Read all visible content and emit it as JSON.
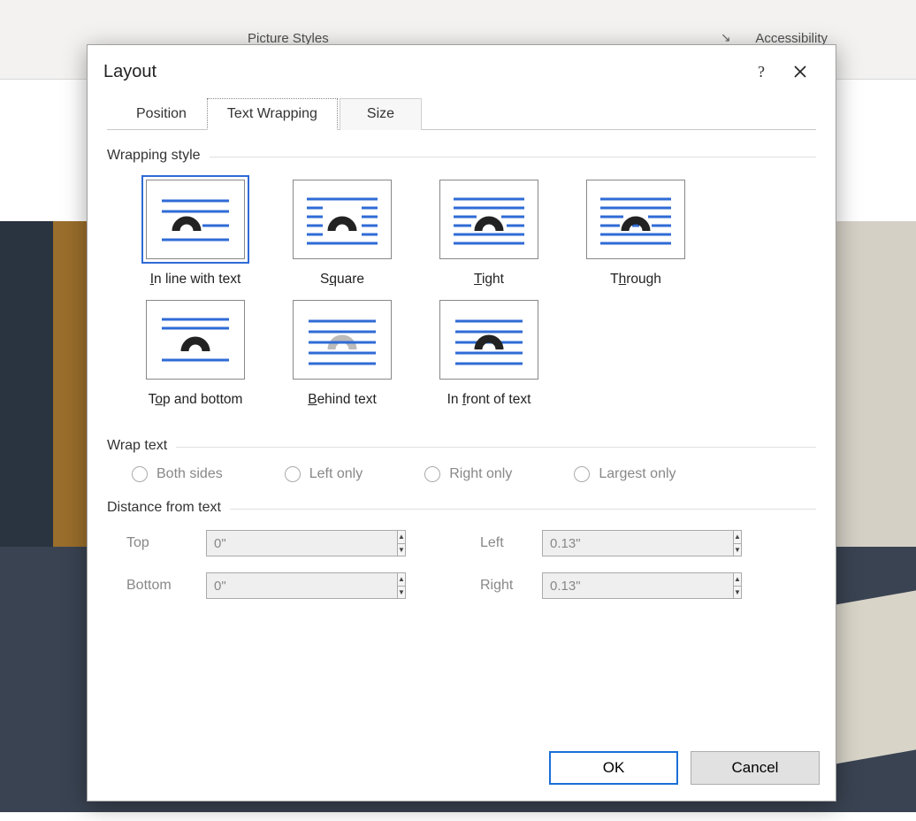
{
  "ribbon": {
    "group_styles": "Picture Styles",
    "group_access": "Accessibility"
  },
  "dialog": {
    "title": "Layout",
    "tabs": {
      "position": "Position",
      "wrapping": "Text Wrapping",
      "size": "Size"
    },
    "wrapping_style_label": "Wrapping style",
    "styles": {
      "inline": "In line with text",
      "square": "Square",
      "tight": "Tight",
      "through": "Through",
      "topbottom": "Top and bottom",
      "behind": "Behind text",
      "infront": "In front of text"
    },
    "wrap_text_label": "Wrap text",
    "wrap_options": {
      "both": "Both sides",
      "left": "Left only",
      "right": "Right only",
      "largest": "Largest only"
    },
    "distance_label": "Distance from text",
    "distance": {
      "top_label": "Top",
      "top_value": "0\"",
      "bottom_label": "Bottom",
      "bottom_value": "0\"",
      "left_label": "Left",
      "left_value": "0.13\"",
      "right_label": "Right",
      "right_value": "0.13\""
    },
    "buttons": {
      "ok": "OK",
      "cancel": "Cancel"
    }
  }
}
